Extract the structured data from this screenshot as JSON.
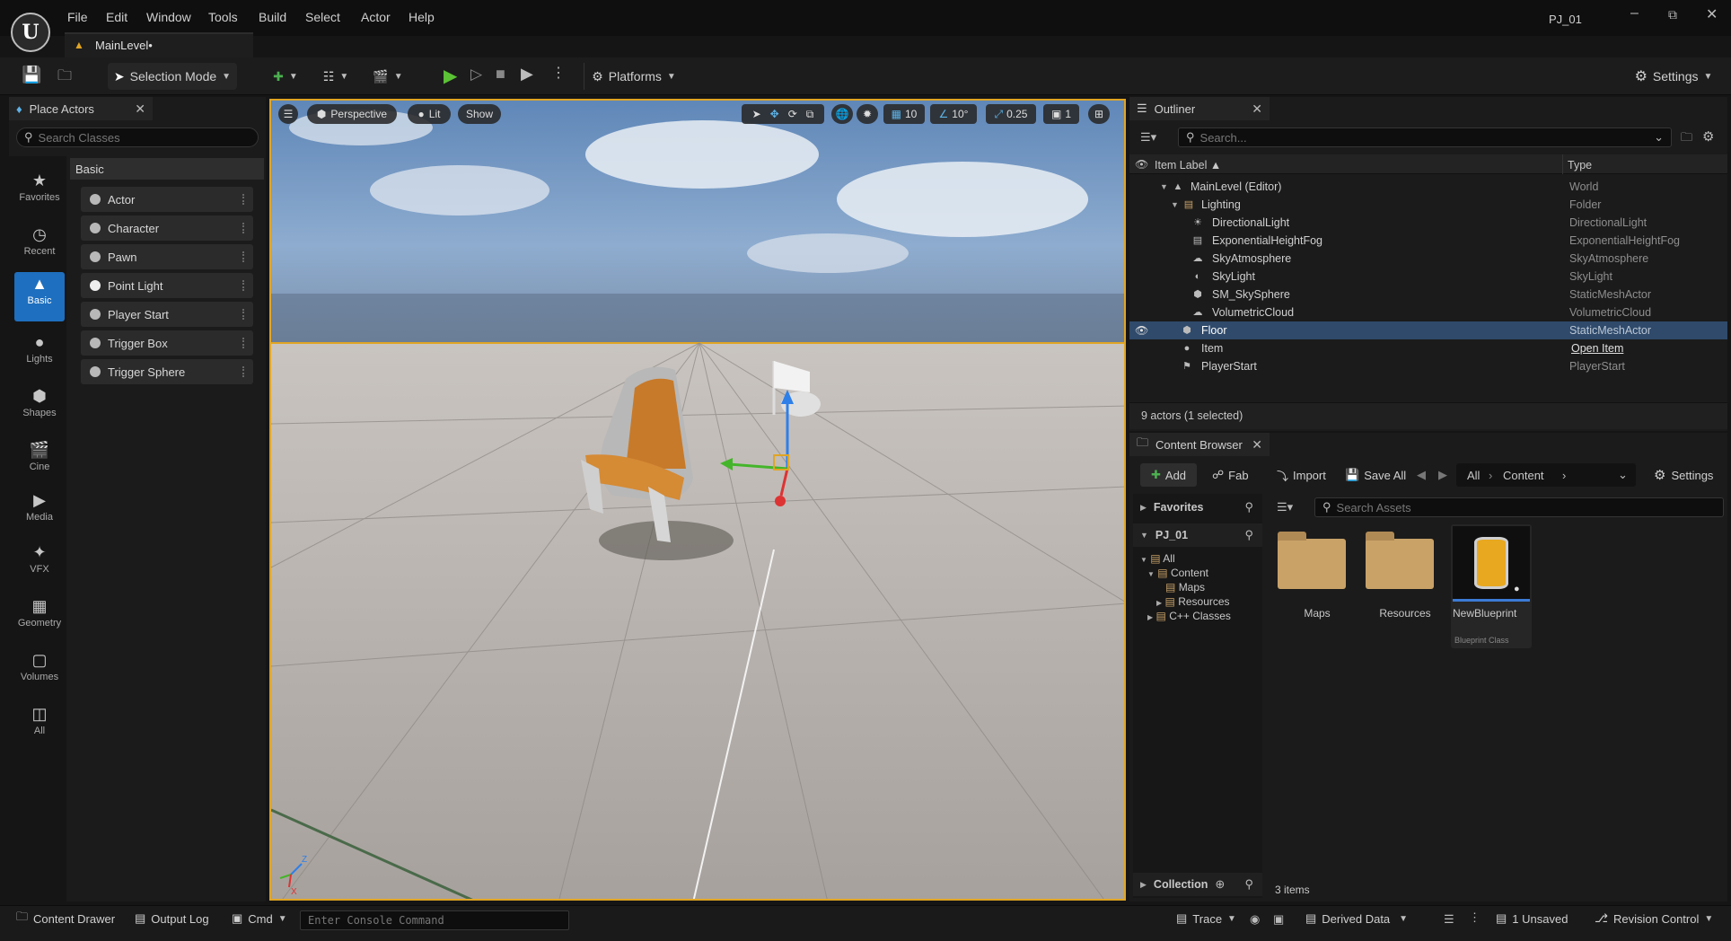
{
  "window": {
    "project": "PJ_01",
    "level_tab": "MainLevel•"
  },
  "menu": [
    "File",
    "Edit",
    "Window",
    "Tools",
    "Build",
    "Select",
    "Actor",
    "Help"
  ],
  "toolbar": {
    "mode": "Selection Mode",
    "platforms": "Platforms",
    "settings": "Settings"
  },
  "place_actors": {
    "title": "Place Actors",
    "search_placeholder": "Search Classes",
    "categories": [
      "Favorites",
      "Recent",
      "Basic",
      "Lights",
      "Shapes",
      "Cine",
      "Media",
      "VFX",
      "Geometry",
      "Volumes",
      "All"
    ],
    "section": "Basic",
    "items": [
      "Actor",
      "Character",
      "Pawn",
      "Point Light",
      "Player Start",
      "Trigger Box",
      "Trigger Sphere"
    ]
  },
  "viewport": {
    "perspective": "Perspective",
    "lit": "Lit",
    "show": "Show",
    "grid": "10",
    "angle": "10°",
    "scale": "0.25",
    "camera": "1"
  },
  "outliner": {
    "title": "Outliner",
    "search_placeholder": "Search...",
    "col_label": "Item Label ▲",
    "col_type": "Type",
    "rows": [
      {
        "label": "MainLevel (Editor)",
        "type": "World"
      },
      {
        "label": "Lighting",
        "type": "Folder"
      },
      {
        "label": "DirectionalLight",
        "type": "DirectionalLight"
      },
      {
        "label": "ExponentialHeightFog",
        "type": "ExponentialHeightFog"
      },
      {
        "label": "SkyAtmosphere",
        "type": "SkyAtmosphere"
      },
      {
        "label": "SkyLight",
        "type": "SkyLight"
      },
      {
        "label": "SM_SkySphere",
        "type": "StaticMeshActor"
      },
      {
        "label": "VolumetricCloud",
        "type": "VolumetricCloud"
      },
      {
        "label": "Floor",
        "type": "StaticMeshActor"
      },
      {
        "label": "Item",
        "type": "Open Item"
      },
      {
        "label": "PlayerStart",
        "type": "PlayerStart"
      }
    ],
    "status": "9 actors (1 selected)"
  },
  "content_browser": {
    "title": "Content Browser",
    "add": "Add",
    "fab": "Fab",
    "import": "Import",
    "save_all": "Save All",
    "path": [
      "All",
      "Content"
    ],
    "settings": "Settings",
    "favorites": "Favorites",
    "project": "PJ_01",
    "tree": [
      "All",
      "Content",
      "Maps",
      "Resources",
      "C++ Classes"
    ],
    "search_placeholder": "Search Assets",
    "assets": [
      {
        "name": "Maps",
        "sub": ""
      },
      {
        "name": "Resources",
        "sub": ""
      },
      {
        "name": "NewBlueprint",
        "sub": "Blueprint Class"
      }
    ],
    "count": "3 items",
    "collection": "Collection"
  },
  "statusbar": {
    "content_drawer": "Content Drawer",
    "output_log": "Output Log",
    "cmd": "Cmd",
    "console_placeholder": "Enter Console Command",
    "trace": "Trace",
    "derived_data": "Derived Data",
    "unsaved": "1 Unsaved",
    "revision": "Revision Control"
  }
}
